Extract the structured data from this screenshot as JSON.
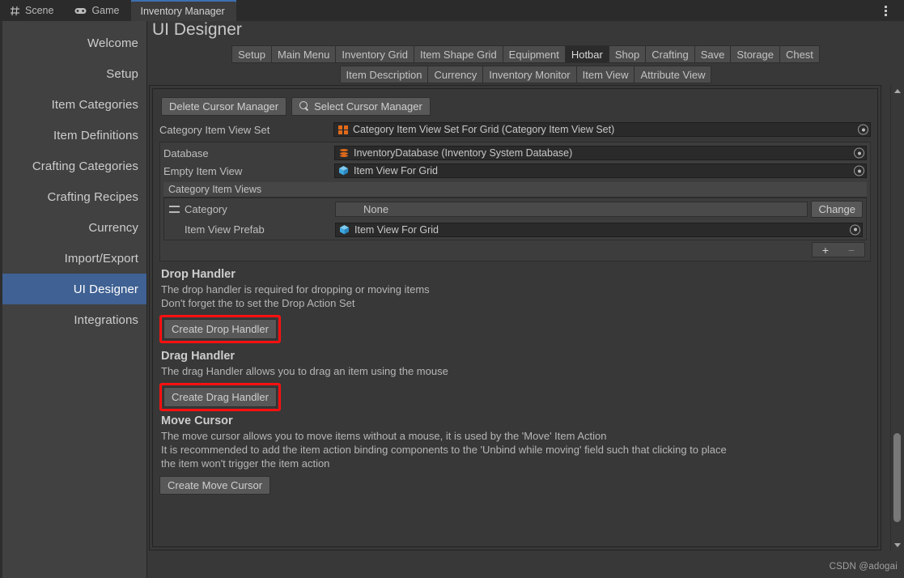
{
  "window": {
    "tabs": [
      {
        "label": "Scene",
        "icon": "grid-icon",
        "active": false
      },
      {
        "label": "Game",
        "icon": "gamepad-icon",
        "active": false
      },
      {
        "label": "Inventory Manager",
        "icon": "none",
        "active": true
      }
    ],
    "menu_icon": "kebab-menu-icon"
  },
  "page": {
    "title": "UI Designer"
  },
  "sidebar": {
    "items": [
      {
        "label": "Welcome",
        "selected": false
      },
      {
        "label": "Setup",
        "selected": false
      },
      {
        "label": "Item Categories",
        "selected": false
      },
      {
        "label": "Item Definitions",
        "selected": false
      },
      {
        "label": "Crafting Categories",
        "selected": false
      },
      {
        "label": "Crafting Recipes",
        "selected": false
      },
      {
        "label": "Currency",
        "selected": false
      },
      {
        "label": "Import/Export",
        "selected": false
      },
      {
        "label": "UI Designer",
        "selected": true
      },
      {
        "label": "Integrations",
        "selected": false
      }
    ],
    "selected_color": "#3f6193"
  },
  "toolbar": {
    "row1": [
      {
        "label": "Setup",
        "selected": false
      },
      {
        "label": "Main Menu",
        "selected": false
      },
      {
        "label": "Inventory Grid",
        "selected": false
      },
      {
        "label": "Item Shape Grid",
        "selected": false
      },
      {
        "label": "Equipment",
        "selected": false
      },
      {
        "label": "Hotbar",
        "selected": true
      },
      {
        "label": "Shop",
        "selected": false
      },
      {
        "label": "Crafting",
        "selected": false
      },
      {
        "label": "Save",
        "selected": false
      },
      {
        "label": "Storage",
        "selected": false
      },
      {
        "label": "Chest",
        "selected": false
      }
    ],
    "row2": [
      {
        "label": "Item Description",
        "selected": false
      },
      {
        "label": "Currency",
        "selected": false
      },
      {
        "label": "Inventory Monitor",
        "selected": false
      },
      {
        "label": "Item View",
        "selected": false
      },
      {
        "label": "Attribute View",
        "selected": false
      }
    ]
  },
  "inspector": {
    "action_buttons": [
      {
        "label": "Delete Cursor Manager",
        "icon": "none"
      },
      {
        "label": "Select Cursor Manager",
        "icon": "search-icon"
      }
    ],
    "fields": [
      {
        "label": "Category Item View Set",
        "value": "Category Item View Set For Grid (Category Item View Set)",
        "icon": "grid-asset-icon"
      },
      {
        "label": "Database",
        "value": "InventoryDatabase (Inventory System Database)",
        "icon": "database-icon"
      },
      {
        "label": "Empty Item View",
        "value": "Item View For Grid",
        "icon": "prefab-cube-icon"
      }
    ],
    "list": {
      "header": "Category Item Views",
      "element": {
        "label": "Category",
        "value": "None",
        "change_label": "Change",
        "sub_label": "Item View Prefab",
        "sub_value": "Item View For Grid",
        "sub_icon": "prefab-cube-icon"
      },
      "add_label": "+",
      "remove_label": "−"
    },
    "sections": [
      {
        "title": "Drop Handler",
        "lines": [
          "The drop handler is required for dropping or moving items",
          "Don't forget the to set the Drop Action Set"
        ],
        "button": "Create Drop Handler",
        "highlighted": true
      },
      {
        "title": "Drag Handler",
        "lines": [
          "The drag Handler allows you to drag an item using the mouse"
        ],
        "button": "Create Drag Handler",
        "highlighted": true
      },
      {
        "title": "Move Cursor",
        "lines": [
          "The move cursor allows you to move items without a mouse, it is used by the 'Move' Item Action",
          "It is recommended to add the item action binding components to the 'Unbind while moving' field such that clicking to place",
          "the item won't trigger the item action"
        ],
        "button": "Create Move Cursor",
        "highlighted": false
      }
    ],
    "highlight_color": "#ff1010"
  },
  "scrollbar": {
    "up": "scroll-up-arrow",
    "down": "scroll-down-arrow"
  },
  "watermark": {
    "text": "CSDN @adogai"
  }
}
